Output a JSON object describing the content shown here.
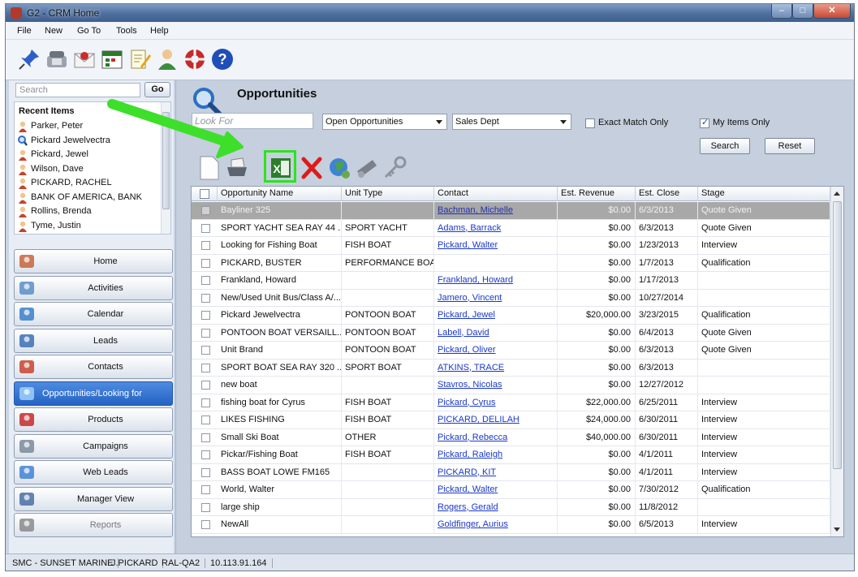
{
  "window": {
    "title": "G2 - CRM Home"
  },
  "menu": [
    "File",
    "New",
    "Go To",
    "Tools",
    "Help"
  ],
  "toolbar_icons": [
    "pushpin-icon",
    "phone-icon",
    "email-icon",
    "calendar-icon",
    "notes-icon",
    "user-icon",
    "lifesaver-icon",
    "help-icon"
  ],
  "search": {
    "placeholder": "Search",
    "go_label": "Go"
  },
  "recent": {
    "title": "Recent Items",
    "items": [
      {
        "label": "Parker, Peter",
        "icon": "contact-icon"
      },
      {
        "label": "Pickard Jewelvectra",
        "icon": "opportunity-icon"
      },
      {
        "label": "Pickard, Jewel",
        "icon": "contact-icon"
      },
      {
        "label": "Wilson, Dave",
        "icon": "contact-icon"
      },
      {
        "label": "PICKARD, RACHEL",
        "icon": "contact-icon"
      },
      {
        "label": "BANK OF AMERICA, BANK",
        "icon": "contact-icon"
      },
      {
        "label": "Rollins, Brenda",
        "icon": "contact-icon"
      },
      {
        "label": "Tyme, Justin",
        "icon": "contact-icon"
      }
    ]
  },
  "nav": [
    {
      "label": "Home",
      "icon": "home-icon"
    },
    {
      "label": "Activities",
      "icon": "activities-icon"
    },
    {
      "label": "Calendar",
      "icon": "calendar-icon"
    },
    {
      "label": "Leads",
      "icon": "leads-icon"
    },
    {
      "label": "Contacts",
      "icon": "contacts-icon"
    },
    {
      "label": "Opportunities/Looking for",
      "icon": "opportunities-icon",
      "active": true
    },
    {
      "label": "Products",
      "icon": "products-icon"
    },
    {
      "label": "Campaigns",
      "icon": "campaigns-icon"
    },
    {
      "label": "Web Leads",
      "icon": "web-leads-icon"
    },
    {
      "label": "Manager View",
      "icon": "manager-view-icon"
    },
    {
      "label": "Reports",
      "icon": "reports-icon",
      "disabled": true
    }
  ],
  "main": {
    "title": "Opportunities",
    "look_for_placeholder": "Look For",
    "filter_status": "Open Opportunities",
    "filter_dept": "Sales Dept",
    "exact_match_label": "Exact Match Only",
    "exact_match_checked": false,
    "my_items_label": "My Items Only",
    "my_items_checked": true,
    "search_button": "Search",
    "reset_button": "Reset",
    "actions": [
      "new-document-icon",
      "print-icon",
      "excel-export-icon",
      "delete-icon",
      "globe-icon",
      "telescope-icon",
      "key-icon"
    ]
  },
  "table": {
    "columns": [
      "Opportunity Name",
      "Unit Type",
      "Contact",
      "Est. Revenue",
      "Est. Close",
      "Stage"
    ],
    "rows": [
      [
        "Bayliner 325",
        "",
        "Bachman, Michelle",
        "$0.00",
        "6/3/2013",
        "Quote Given"
      ],
      [
        "SPORT YACHT SEA RAY 44 ...",
        "SPORT YACHT",
        "Adams, Barrack",
        "$0.00",
        "6/3/2013",
        "Quote Given"
      ],
      [
        "Looking for Fishing Boat",
        "FISH BOAT",
        "Pickard, Walter",
        "$0.00",
        "1/23/2013",
        "Interview"
      ],
      [
        "PICKARD, BUSTER",
        "PERFORMANCE BOAT",
        "",
        "$0.00",
        "1/7/2013",
        "Qualification"
      ],
      [
        "Frankland, Howard",
        "",
        "Frankland, Howard",
        "$0.00",
        "1/17/2013",
        ""
      ],
      [
        "New/Used Unit Bus/Class A/...",
        "",
        "Jamero, Vincent",
        "$0.00",
        "10/27/2014",
        ""
      ],
      [
        "Pickard Jewelvectra",
        "PONTOON BOAT",
        "Pickard, Jewel",
        "$20,000.00",
        "3/23/2015",
        "Qualification"
      ],
      [
        "PONTOON BOAT VERSAILL...",
        "PONTOON BOAT",
        "Labell, David",
        "$0.00",
        "6/4/2013",
        "Quote Given"
      ],
      [
        "Unit Brand",
        "PONTOON BOAT",
        "Pickard, Oliver",
        "$0.00",
        "6/3/2013",
        "Quote Given"
      ],
      [
        "SPORT BOAT SEA RAY 320 ...",
        "SPORT BOAT",
        "ATKINS, TRACE",
        "$0.00",
        "6/3/2013",
        ""
      ],
      [
        "new boat",
        "",
        "Stavros, Nicolas",
        "$0.00",
        "12/27/2012",
        ""
      ],
      [
        "fishing boat for Cyrus",
        "FISH BOAT",
        "Pickard, Cyrus",
        "$22,000.00",
        "6/25/2011",
        "Interview"
      ],
      [
        "LIKES FISHING",
        "FISH BOAT",
        "PICKARD, DELILAH",
        "$24,000.00",
        "6/30/2011",
        "Interview"
      ],
      [
        "Small Ski Boat",
        "OTHER",
        "Pickard, Rebecca",
        "$40,000.00",
        "6/30/2011",
        "Interview"
      ],
      [
        "Pickar/Fishing Boat",
        "FISH BOAT",
        "Pickard, Raleigh",
        "$0.00",
        "4/1/2011",
        "Interview"
      ],
      [
        "BASS BOAT LOWE FM165",
        "",
        "PICKARD, KIT",
        "$0.00",
        "4/1/2011",
        "Interview"
      ],
      [
        "World, Walter",
        "",
        "Pickard, Walter",
        "$0.00",
        "7/30/2012",
        "Qualification"
      ],
      [
        "large ship",
        "",
        "Rogers, Gerald",
        "$0.00",
        "11/8/2012",
        ""
      ],
      [
        "NewAll",
        "",
        "Goldfinger, Aurius",
        "$0.00",
        "6/5/2013",
        "Interview"
      ]
    ],
    "selected_row": 0
  },
  "status": [
    "SMC - SUNSET MARINE",
    "J.PICKARD",
    "RAL-QA2",
    "10.113.91.164"
  ],
  "colors": {
    "accent": "#2563c5",
    "highlight": "#2fe31f",
    "link": "#1a38c8"
  }
}
